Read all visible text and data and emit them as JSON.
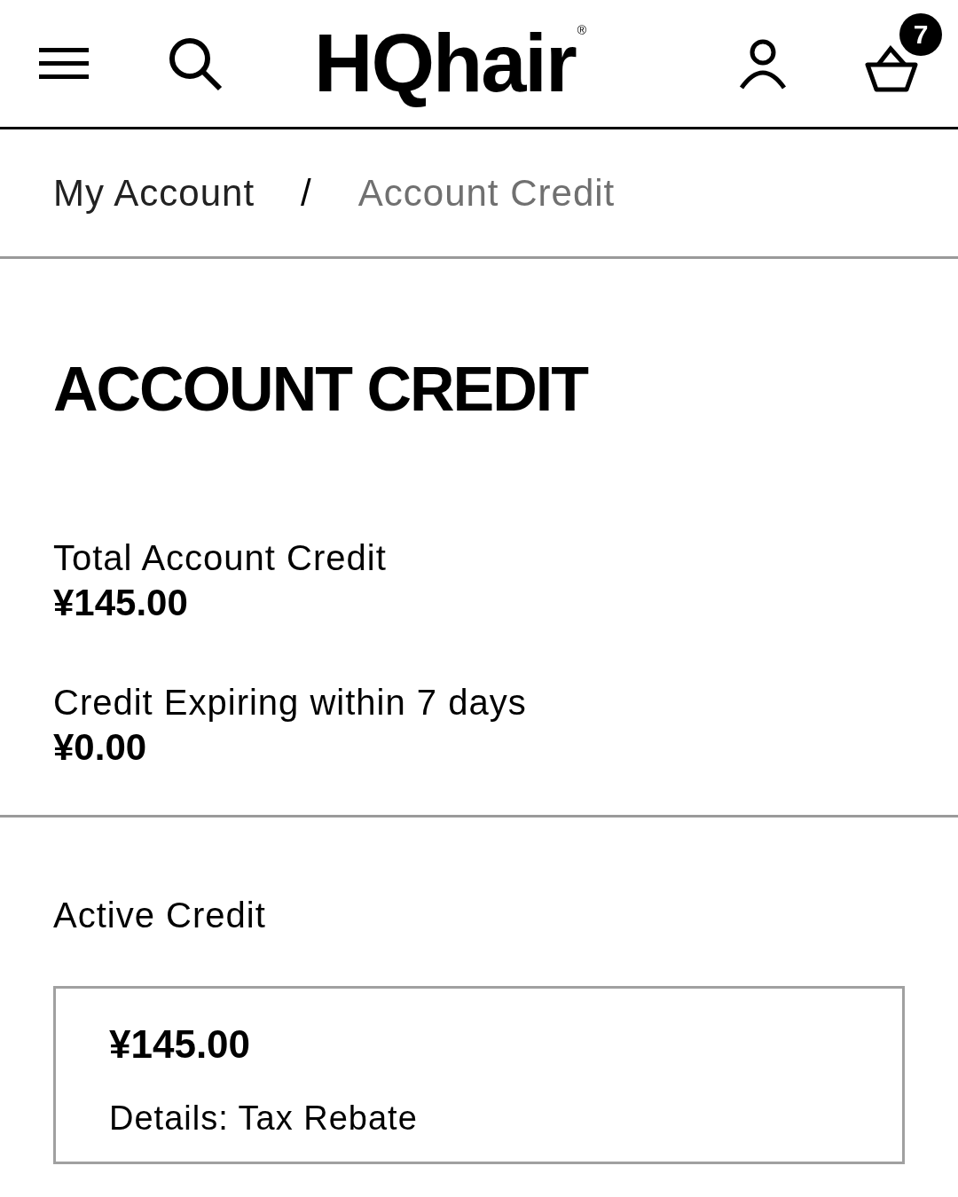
{
  "header": {
    "logo": "HQhair",
    "logo_mark": "®",
    "basket_count": "7"
  },
  "breadcrumb": [
    {
      "label": "My Account",
      "current": false
    },
    {
      "label": "/",
      "kind": "separator"
    },
    {
      "label": "Account Credit",
      "current": true
    }
  ],
  "title": "ACCOUNT CREDIT",
  "summary": [
    {
      "label": "Total Account Credit",
      "amount": "¥145.00"
    },
    {
      "label": "Credit Expiring within 7 days",
      "amount": "¥0.00"
    }
  ],
  "active_credit": {
    "heading": "Active Credit",
    "cards": [
      {
        "amount": "¥145.00",
        "details": "Details: Tax Rebate"
      }
    ]
  }
}
